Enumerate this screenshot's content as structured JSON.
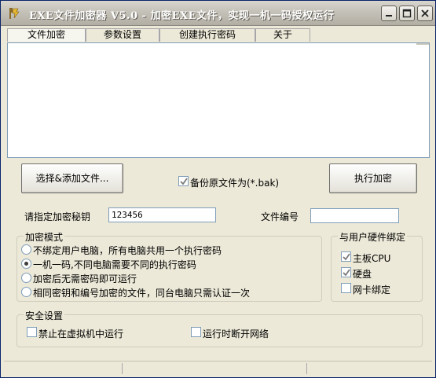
{
  "window": {
    "title": "EXE文件加密器 V5.0 - 加密EXE文件，实现一机一码授权运行",
    "colors": {
      "face": "#ece9d8",
      "field_border": "#7f9db9",
      "title_gradient": "#c4c1b8"
    }
  },
  "tabs": [
    {
      "label": "文件加密",
      "active": true
    },
    {
      "label": "参数设置",
      "active": false
    },
    {
      "label": "创建执行密码",
      "active": false
    },
    {
      "label": "关于",
      "active": false
    }
  ],
  "actions": {
    "add_file_label": "选择&添加文件...",
    "backup_label": "备份原文件为(*.bak)",
    "backup_checked": true,
    "encrypt_label": "执行加密"
  },
  "key_row": {
    "key_label": "请指定加密秘钥",
    "key_value": "123456",
    "file_no_label": "文件编号",
    "file_no_value": ""
  },
  "encrypt_mode": {
    "title": "加密模式",
    "options": [
      {
        "label": "不绑定用户电脑，所有电脑共用一个执行密码",
        "selected": false
      },
      {
        "label": "一机一码,不同电脑需要不同的执行密码",
        "selected": true
      },
      {
        "label": "加密后无需密码即可运行",
        "selected": false
      },
      {
        "label": "相同密钥和编号加密的文件，同台电脑只需认证一次",
        "selected": false
      }
    ]
  },
  "hardware_bind": {
    "title": "与用户硬件绑定",
    "options": [
      {
        "label": "主板CPU",
        "checked": true
      },
      {
        "label": "硬盘",
        "checked": true
      },
      {
        "label": "网卡绑定",
        "checked": false
      }
    ]
  },
  "security": {
    "title": "安全设置",
    "options": [
      {
        "label": "禁止在虚拟机中运行",
        "checked": false
      },
      {
        "label": "运行时断开网络",
        "checked": false
      }
    ]
  }
}
